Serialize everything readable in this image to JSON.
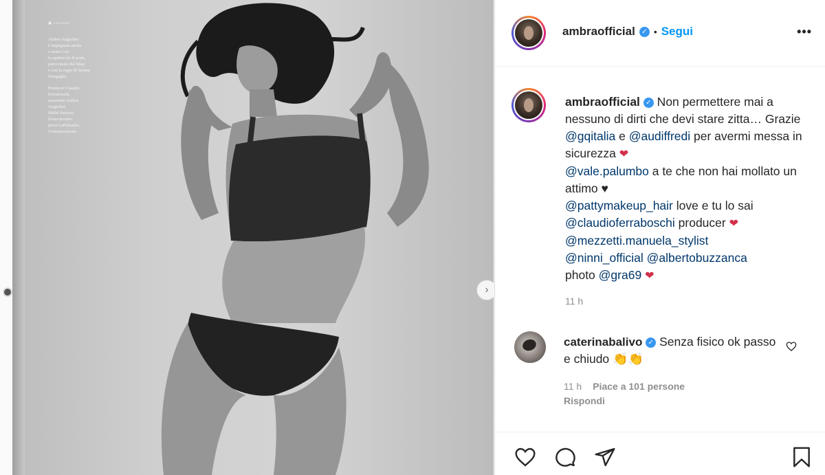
{
  "photo": {
    "credits": {
      "section_tag": "▣ sezione",
      "paragraph1": "Ambra Angiolini\nè impegnata anche\na teatro con\nlo spettacolo Il nodo,\npatrocinato dal Mise\ne con la regia di Serena\nSinigaglia",
      "paragraph2": "Producer Claudio\nFerraboschi,\nassistente Ambra\nAngiolini\nH&M Patrizia\nDelacutombo\npress LaPalumbo\nComunicazione"
    },
    "next_arrow": "›"
  },
  "header": {
    "username": "ambraofficial",
    "verified_mark": "✓",
    "separator": "•",
    "follow_label": "Segui",
    "more_label": "•••"
  },
  "caption": {
    "username": "ambraofficial",
    "verified_mark": "✓",
    "line1": " Non permettere mai a nessuno di dirti che devi stare zitta…",
    "line2_prefix": "Grazie ",
    "mention_gq": "@gqitalia",
    "line2_mid": " e ",
    "mention_audiffredi": "@audiffredi",
    "line2_suffix": " per avermi messa in sicurezza ",
    "heart1": "❤",
    "mention_vale": "@vale.palumbo",
    "line3": " a te che non hai mollato un attimo ",
    "small_heart": "♥",
    "mention_patty": "@pattymakeup_hair",
    "line4": " love e tu lo sai",
    "mention_claudio": "@claudioferraboschi",
    "line5": " producer ",
    "heart2": "❤",
    "mention_mezzetti": "@mezzetti.manuela_stylist",
    "mention_ninni": "@ninni_official",
    "mention_alberto": "@albertobuzzanca",
    "photo_label": "photo ",
    "mention_gra": "@gra69",
    "heart3": "❤"
  },
  "timestamp": "11 h",
  "comment": {
    "username": "caterinabalivo",
    "verified_mark": "✓",
    "text": " Senza fisico ok passo e chiudo ",
    "emoji": "👏👏",
    "time": "11 h",
    "likes": "Piace a 101 persone",
    "reply_label": "Rispondi"
  },
  "actions": {
    "like_icon": "heart-outline-icon",
    "comment_icon": "comment-bubble-icon",
    "share_icon": "paper-plane-icon",
    "save_icon": "bookmark-icon"
  },
  "colors": {
    "accent_blue": "#0095f6",
    "mention": "#00376b",
    "verified": "#3897f0",
    "muted": "#8e8e8e",
    "heart": "#d32f4a"
  }
}
